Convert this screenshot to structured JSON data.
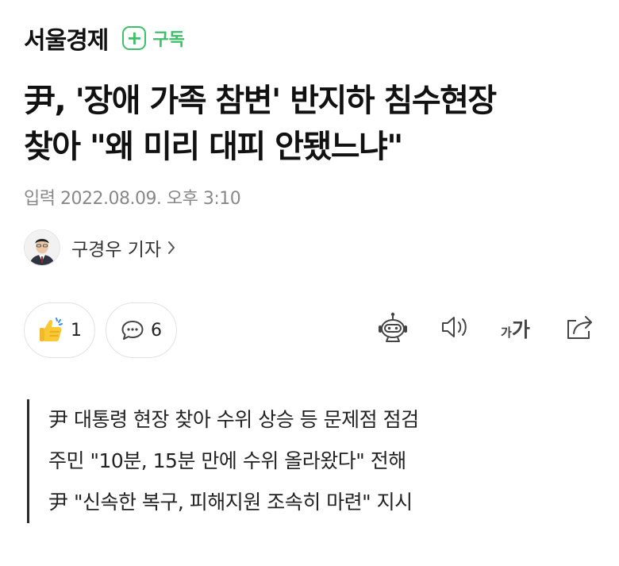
{
  "header": {
    "press_name": "서울경제",
    "subscribe_label": "구독",
    "subscribe_icon": "plus-icon",
    "accent_color": "#3fbf6a"
  },
  "article": {
    "title_line1": "尹, '장애 가족 참변' 반지하 침수현장",
    "title_line2": "찾아 \"왜 미리 대피 안됐느냐\"",
    "date": "입력 2022.08.09. 오후 3:10",
    "reporter": "구경우 기자"
  },
  "actions": {
    "like_count": "1",
    "comment_count": "6",
    "tools": [
      "robot-summary-icon",
      "speaker-icon",
      "font-size-icon",
      "share-icon"
    ],
    "font_size_small": "가",
    "font_size_large": "가"
  },
  "summary": [
    "尹 대통령 현장 찾아 수위 상승 등 문제점 점검",
    "주민 \"10분, 15분 만에 수위 올라왔다\" 전해",
    "尹 \"신속한 복구, 피해지원 조속히 마련\" 지시"
  ]
}
